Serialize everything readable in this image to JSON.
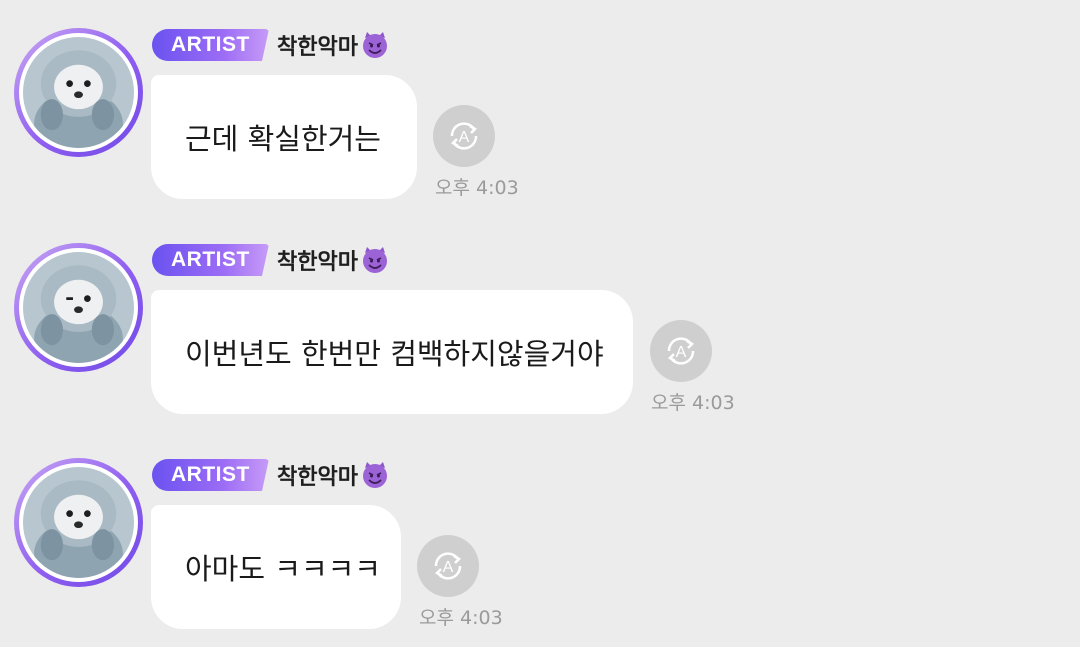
{
  "messages": [
    {
      "badge": "ARTIST",
      "nickname": "착한악마",
      "nickname_emoji": "smiling-devil-emoji",
      "text": "근데 확실한거는",
      "time": "오후 4:03",
      "translate_icon": "translate-icon"
    },
    {
      "badge": "ARTIST",
      "nickname": "착한악마",
      "nickname_emoji": "smiling-devil-emoji",
      "text": "이번년도 한번만 컴백하지않을거야",
      "time": "오후 4:03",
      "translate_icon": "translate-icon"
    },
    {
      "badge": "ARTIST",
      "nickname": "착한악마",
      "nickname_emoji": "smiling-devil-emoji",
      "text": "아마도 ㅋㅋㅋㅋ",
      "time": "오후 4:03",
      "translate_icon": "translate-icon"
    }
  ],
  "colors": {
    "background": "#ececec",
    "bubble": "#ffffff",
    "badge_start": "#6b52f0",
    "badge_end": "#c69bf6",
    "translate_button": "#cfcfcf",
    "time_text": "#9a9a9a"
  }
}
